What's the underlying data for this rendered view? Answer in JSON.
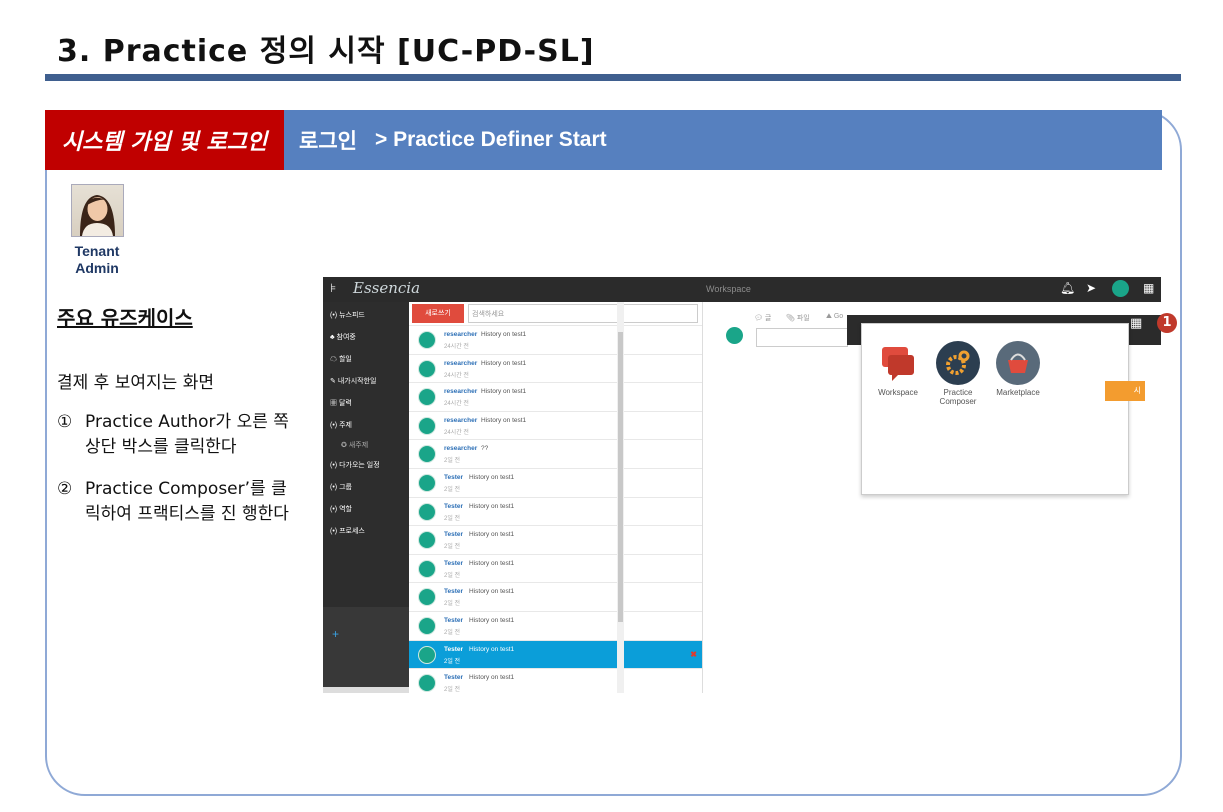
{
  "slide": {
    "title": "3. Practice 정의 시작 [UC-PD-SL]",
    "header_section": "시스템 가입 및 로그인",
    "header_crumb_1": "로그인",
    "header_crumb_2": "> Practice Definer Start",
    "role_line1": "Tenant",
    "role_line2": "Admin",
    "uc_heading": "주요 유즈케이스",
    "description": "결제 후 보여지는 화면",
    "steps": [
      {
        "num": "①",
        "text": "Practice Author가 오른 쪽 상단 박스를 클릭한다"
      },
      {
        "num": "②",
        "text": " Practice Composer’를 클릭하여 프랙티스를 진 행한다"
      }
    ],
    "marker": "1",
    "colors": {
      "title_rule": "#3f5f8f",
      "header_band": "#5680bf",
      "header_red": "#c00000",
      "panel_border": "#8fa9d6"
    }
  },
  "app": {
    "brand": "Essencia",
    "topbar_center": "Workspace",
    "topbar_icons": [
      "bell-icon",
      "send-icon",
      "avatar",
      "grid-icon"
    ],
    "sidebar": [
      {
        "label": "뉴스피드",
        "icon": "(•)"
      },
      {
        "label": "참여중",
        "icon": "♣"
      },
      {
        "label": "할일",
        "icon": "☁"
      },
      {
        "label": "내가시작한일",
        "icon": "✎"
      },
      {
        "label": "달력",
        "icon": "▦"
      },
      {
        "label": "주제",
        "icon": "(•)"
      },
      {
        "label": "새주제",
        "icon": "✪"
      },
      {
        "label": "다가오는 일정",
        "icon": "(•)"
      },
      {
        "label": "그룹",
        "icon": "(•)"
      },
      {
        "label": "역할",
        "icon": "(•)"
      },
      {
        "label": "프로세스",
        "icon": "(•)"
      }
    ],
    "sidebar_plus": "+",
    "write_button": "새로쓰기",
    "search_placeholder": "검색하세요",
    "feed": [
      {
        "name": "researcher",
        "msg": "History on test1",
        "time": "24시간 전"
      },
      {
        "name": "researcher",
        "msg": "History on test1",
        "time": "24시간 전"
      },
      {
        "name": "researcher",
        "msg": "History on test1",
        "time": "24시간 전"
      },
      {
        "name": "researcher",
        "msg": "History on test1",
        "time": "24시간 전"
      },
      {
        "name": "researcher",
        "msg": "??",
        "time": "2일 전"
      },
      {
        "name": "Tester",
        "msg": "History on test1",
        "time": "2일 전"
      },
      {
        "name": "Tester",
        "msg": "History on test1",
        "time": "2일 전"
      },
      {
        "name": "Tester",
        "msg": "History on test1",
        "time": "2일 전"
      },
      {
        "name": "Tester",
        "msg": "History on test1",
        "time": "2일 전"
      },
      {
        "name": "Tester",
        "msg": "History on test1",
        "time": "2일 전"
      },
      {
        "name": "Tester",
        "msg": "History on test1",
        "time": "2일 전"
      },
      {
        "name": "Tester",
        "msg": "History on test1",
        "time": "2일 전",
        "selected": true
      },
      {
        "name": "Tester",
        "msg": "History on test1",
        "time": "2일 전"
      }
    ],
    "right_tabs": [
      "글",
      "파일",
      "Go"
    ],
    "apps": [
      {
        "label": "Workspace",
        "icon": "workspace-icon",
        "color": "#e04b3d"
      },
      {
        "label": "Practice Composer",
        "icon": "gear-icon",
        "color": "#2c3e50"
      },
      {
        "label": "Marketplace",
        "icon": "basket-icon",
        "color": "#596a7a"
      }
    ],
    "orange_button": "시"
  }
}
